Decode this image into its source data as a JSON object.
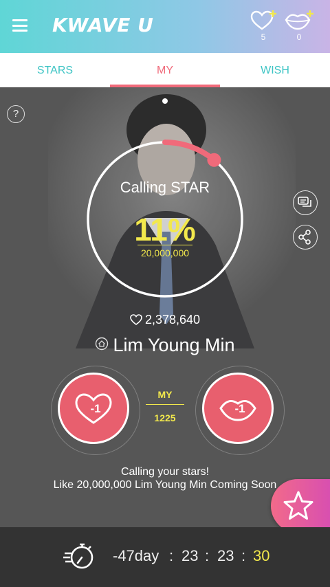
{
  "header": {
    "logo": "KWAVE U",
    "heart_count": "5",
    "lips_count": "0"
  },
  "tabs": [
    {
      "label": "STARS"
    },
    {
      "label": "MY"
    },
    {
      "label": "WISH"
    }
  ],
  "active_tab": "MY",
  "ring": {
    "title": "Calling STAR",
    "percent": "11%",
    "progress": 0.11,
    "goal": "20,000,000"
  },
  "likes": "2,378,640",
  "star_name": "Lim Young Min",
  "actions": {
    "heart_label": "-1",
    "lips_label": "-1",
    "my_label": "MY",
    "my_count": "1225"
  },
  "calling": {
    "line1": "Calling your stars!",
    "line2": "Like 20,000,000 Lim Young Min Coming Soon"
  },
  "timer": {
    "days": "-47day",
    "hours": "23",
    "minutes": "23",
    "seconds": "30",
    "sep": ":"
  },
  "colors": {
    "accent": "#f06a7a",
    "teal": "#3cc4c4",
    "yellow": "#f2e84c",
    "button": "#e85f6e"
  }
}
